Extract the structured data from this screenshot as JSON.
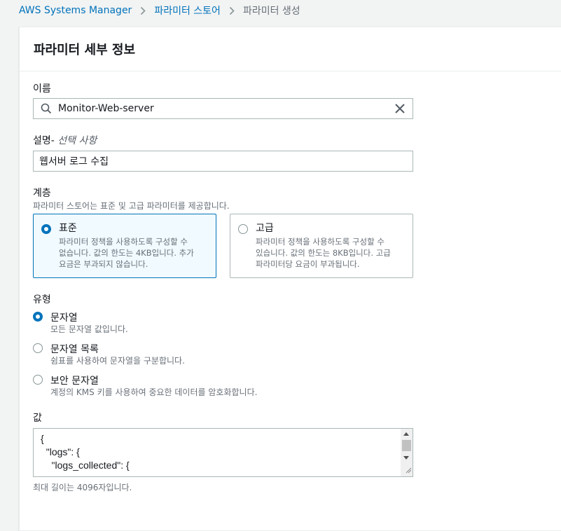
{
  "breadcrumb": {
    "items": [
      "AWS Systems Manager",
      "파라미터 스토어",
      "파라미터 생성"
    ]
  },
  "card": {
    "title": "파라미터 세부 정보"
  },
  "name_field": {
    "label": "이름",
    "value": "Monitor-Web-server",
    "icons": [
      "search-icon",
      "clear-icon"
    ]
  },
  "description_field": {
    "label": "설명-",
    "optional": "선택 사항",
    "value": "웹서버 로그 수집"
  },
  "tier": {
    "label": "계층",
    "description": "파라미터 스토어는 표준 및 고급 파라미터를 제공합니다.",
    "options": [
      {
        "title": "표준",
        "desc_lines": [
          "파라미터 정책을 사용하도록 구성할 수",
          "없습니다. 값의 한도는 4KB입니다. 추가",
          "요금은 부과되지 않습니다."
        ],
        "selected": true
      },
      {
        "title": "고급",
        "desc_lines": [
          "파라미터 정책을 사용하도록 구성할 수",
          "있습니다. 값의 한도는 8KB입니다. 고급",
          "파라미터당 요금이 부과됩니다."
        ],
        "selected": false
      }
    ]
  },
  "type": {
    "label": "유형",
    "options": [
      {
        "title": "문자열",
        "desc": "모든 문자열 값입니다.",
        "selected": true
      },
      {
        "title": "문자열 목록",
        "desc": "쉼표를 사용하여 문자열을 구분합니다.",
        "selected": false
      },
      {
        "title": "보안 문자열",
        "desc": "계정의 KMS 키를 사용하여 중요한 데이터를 암호화합니다.",
        "selected": false
      }
    ]
  },
  "value_field": {
    "label": "값",
    "lines": [
      "{",
      "  \"logs\": {",
      "    \"logs_collected\": {"
    ],
    "hint": "최대 길이는 4096자입니다."
  },
  "colors": {
    "accent": "#0073bb",
    "selected_tile_bg": "#f1faff",
    "border": "#aab7b8",
    "muted_text": "#687078"
  }
}
